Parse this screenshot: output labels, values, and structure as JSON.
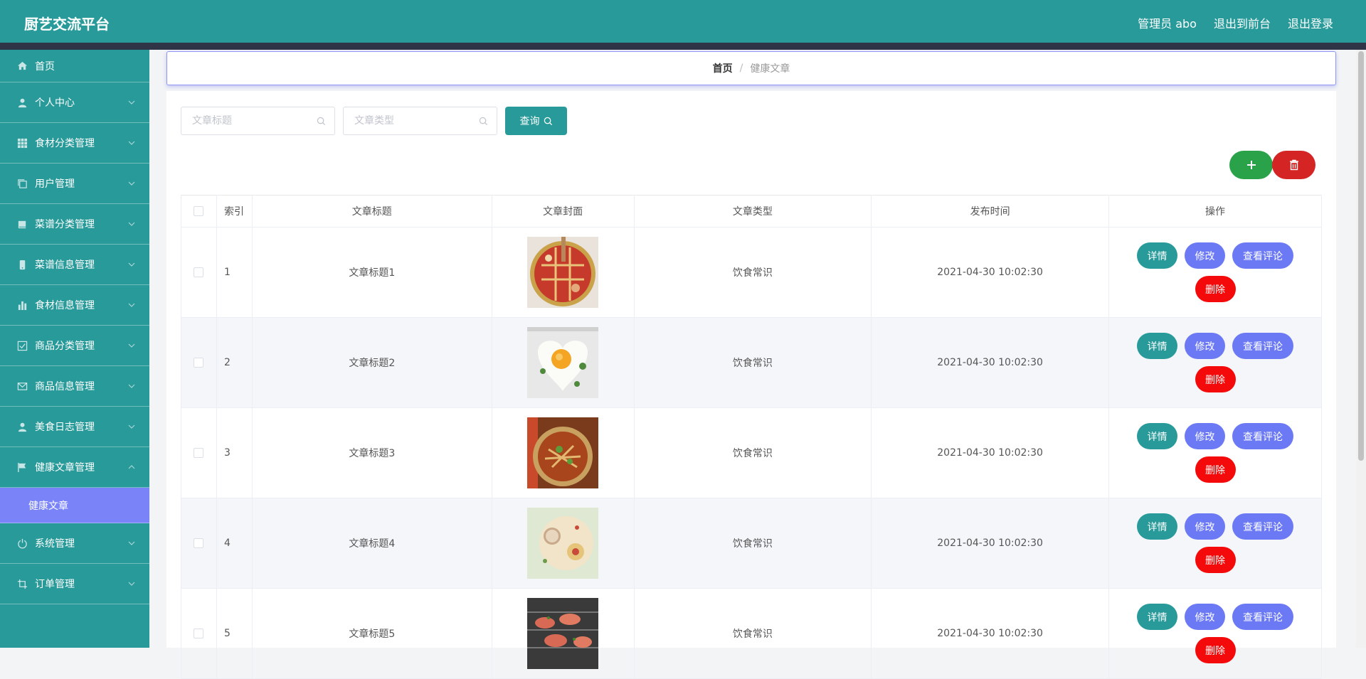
{
  "header": {
    "brand": "厨艺交流平台",
    "admin": "管理员 abo",
    "to_front": "退出到前台",
    "logout": "退出登录"
  },
  "sidebar": {
    "items": [
      {
        "label": "首页",
        "icon": "home-icon"
      },
      {
        "label": "个人中心",
        "icon": "user-icon"
      },
      {
        "label": "食材分类管理",
        "icon": "grid-icon"
      },
      {
        "label": "用户管理",
        "icon": "copy-icon"
      },
      {
        "label": "菜谱分类管理",
        "icon": "book-icon"
      },
      {
        "label": "菜谱信息管理",
        "icon": "phone-icon"
      },
      {
        "label": "食材信息管理",
        "icon": "bar-chart-icon"
      },
      {
        "label": "商品分类管理",
        "icon": "check-square-icon"
      },
      {
        "label": "商品信息管理",
        "icon": "mail-icon"
      },
      {
        "label": "美食日志管理",
        "icon": "user-icon"
      },
      {
        "label": "健康文章管理",
        "icon": "flag-icon"
      },
      {
        "label": "系统管理",
        "icon": "power-icon"
      },
      {
        "label": "订单管理",
        "icon": "crop-icon"
      }
    ],
    "active_sub": "健康文章"
  },
  "breadcrumb": {
    "home": "首页",
    "separator": "/",
    "current": "健康文章"
  },
  "search": {
    "title_placeholder": "文章标题",
    "type_placeholder": "文章类型",
    "query_label": "查询"
  },
  "table": {
    "headers": [
      "索引",
      "文章标题",
      "文章封面",
      "文章类型",
      "发布时间",
      "操作"
    ],
    "rows": [
      {
        "index": "1",
        "title": "文章标题1",
        "type": "饮食常识",
        "time": "2021-04-30 10:02:30"
      },
      {
        "index": "2",
        "title": "文章标题2",
        "type": "饮食常识",
        "time": "2021-04-30 10:02:30"
      },
      {
        "index": "3",
        "title": "文章标题3",
        "type": "饮食常识",
        "time": "2021-04-30 10:02:30"
      },
      {
        "index": "4",
        "title": "文章标题4",
        "type": "饮食常识",
        "time": "2021-04-30 10:02:30"
      },
      {
        "index": "5",
        "title": "文章标题5",
        "type": "饮食常识",
        "time": "2021-04-30 10:02:30"
      }
    ],
    "actions": {
      "detail": "详情",
      "edit": "修改",
      "comments": "查看评论",
      "delete": "删除"
    }
  },
  "colors": {
    "primary": "#289a9a",
    "accent": "#6b79f5",
    "add": "#2aa24a",
    "danger": "#f40a0a"
  }
}
